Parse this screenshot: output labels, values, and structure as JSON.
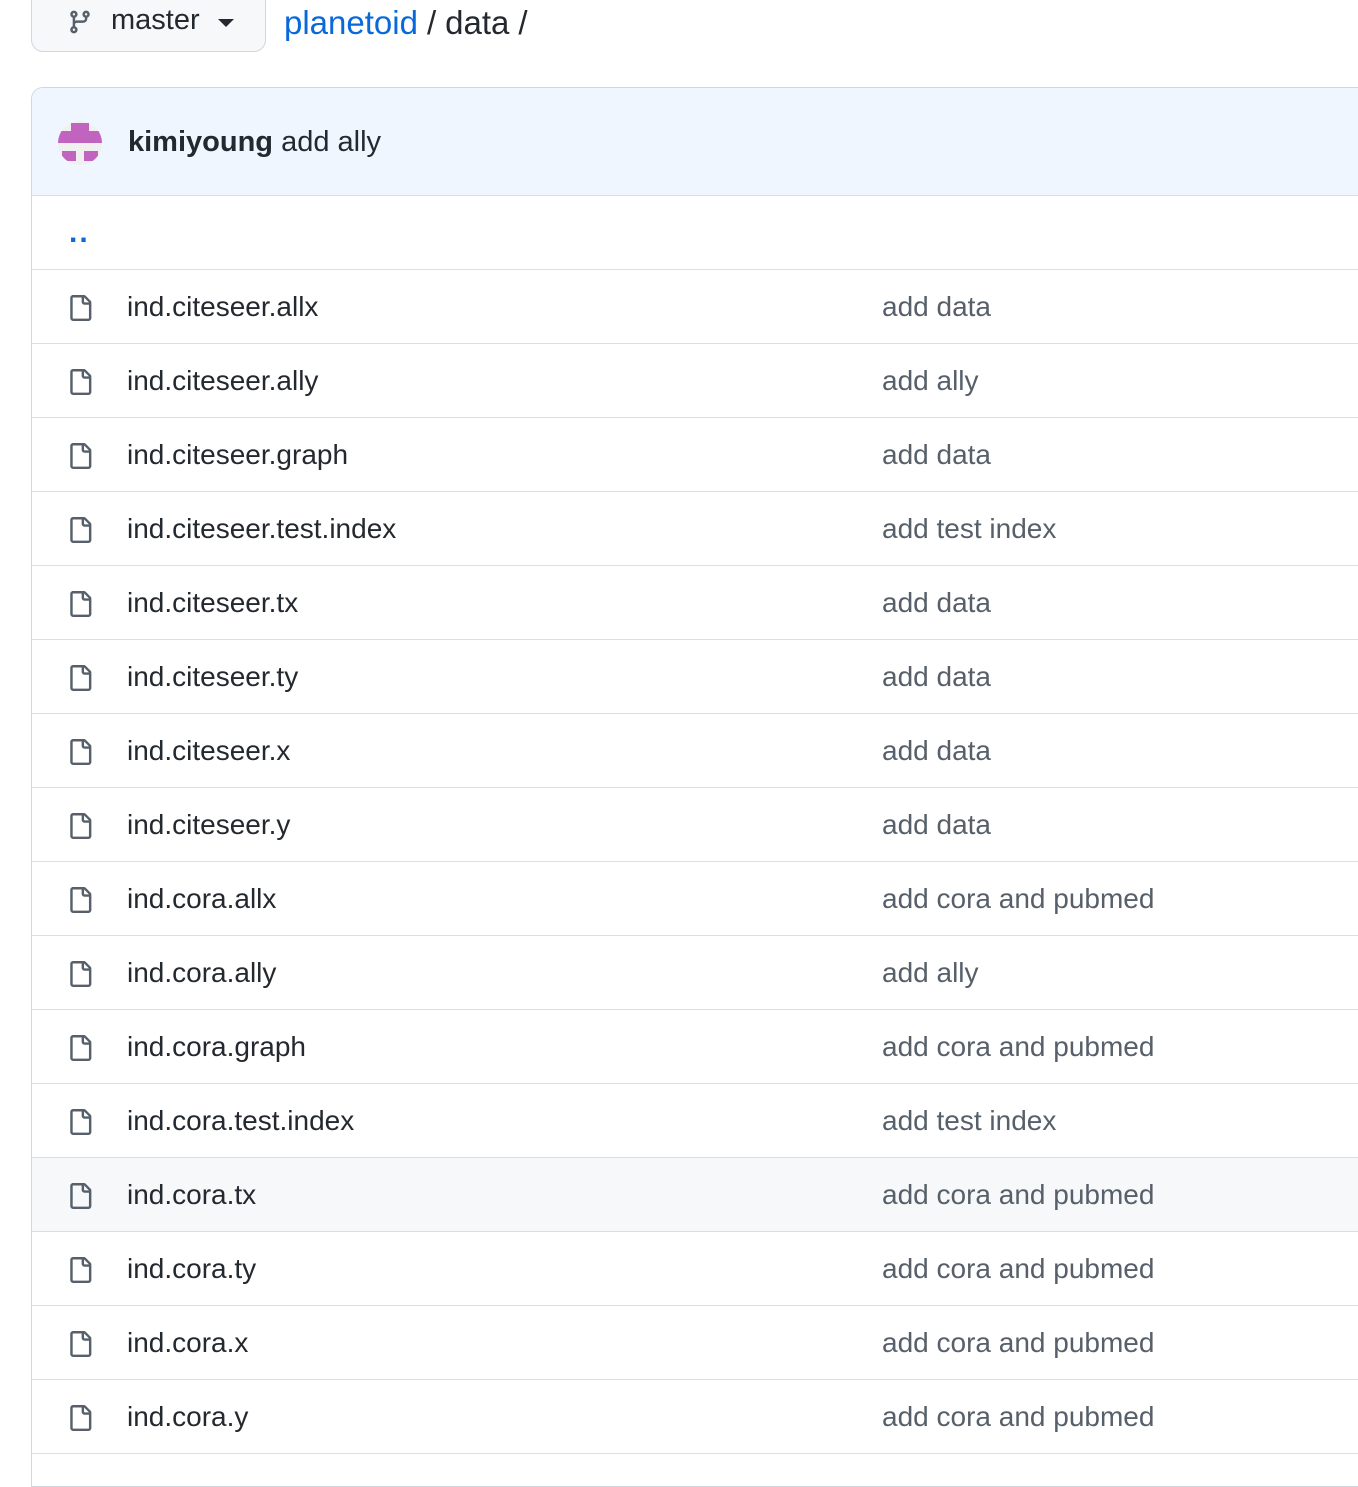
{
  "branch": {
    "label": "master",
    "icon": "git-branch-icon"
  },
  "breadcrumb": {
    "repo": "planetoid",
    "separator": "/",
    "dir": "data",
    "trailing": "/"
  },
  "latest_commit": {
    "author": "kimiyoung",
    "message": "add ally"
  },
  "parent_link": "..",
  "files": [
    {
      "name": "ind.citeseer.allx",
      "commit": "add data"
    },
    {
      "name": "ind.citeseer.ally",
      "commit": "add ally"
    },
    {
      "name": "ind.citeseer.graph",
      "commit": "add data"
    },
    {
      "name": "ind.citeseer.test.index",
      "commit": "add test index"
    },
    {
      "name": "ind.citeseer.tx",
      "commit": "add data"
    },
    {
      "name": "ind.citeseer.ty",
      "commit": "add data"
    },
    {
      "name": "ind.citeseer.x",
      "commit": "add data"
    },
    {
      "name": "ind.citeseer.y",
      "commit": "add data"
    },
    {
      "name": "ind.cora.allx",
      "commit": "add cora and pubmed"
    },
    {
      "name": "ind.cora.ally",
      "commit": "add ally"
    },
    {
      "name": "ind.cora.graph",
      "commit": "add cora and pubmed"
    },
    {
      "name": "ind.cora.test.index",
      "commit": "add test index"
    },
    {
      "name": "ind.cora.tx",
      "commit": "add cora and pubmed"
    },
    {
      "name": "ind.cora.ty",
      "commit": "add cora and pubmed"
    },
    {
      "name": "ind.cora.x",
      "commit": "add cora and pubmed"
    },
    {
      "name": "ind.cora.y",
      "commit": "add cora and pubmed"
    }
  ],
  "colors": {
    "link": "#0969da",
    "text": "#24292f",
    "muted": "#57606a",
    "header_bg": "#f0f6ff",
    "hover_row_bg": "#f6f8fa",
    "avatar": "#c064c0"
  }
}
